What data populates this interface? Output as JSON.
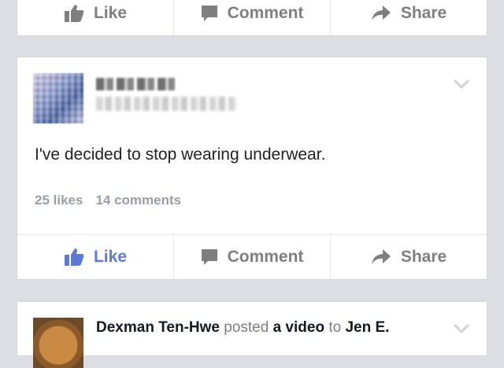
{
  "action_bar": {
    "like_label": "Like",
    "comment_label": "Comment",
    "share_label": "Share"
  },
  "posts": [
    {
      "text": "I've decided to stop wearing underwear.",
      "likes": "25 likes",
      "comments": "14 comments"
    },
    {
      "author": "Dexman Ten-Hwe",
      "verb": "posted",
      "object": "a video",
      "preposition": "to",
      "target": "Jen E."
    }
  ],
  "colors": {
    "background": "#dcdee3",
    "card": "#ffffff",
    "liked_blue": "#5b7bd5",
    "action_gray": "#7f7f7f",
    "stats_gray": "#9a9ea5"
  },
  "icons": [
    "thumbs-up-icon",
    "comment-icon",
    "share-icon",
    "chevron-down-icon"
  ]
}
